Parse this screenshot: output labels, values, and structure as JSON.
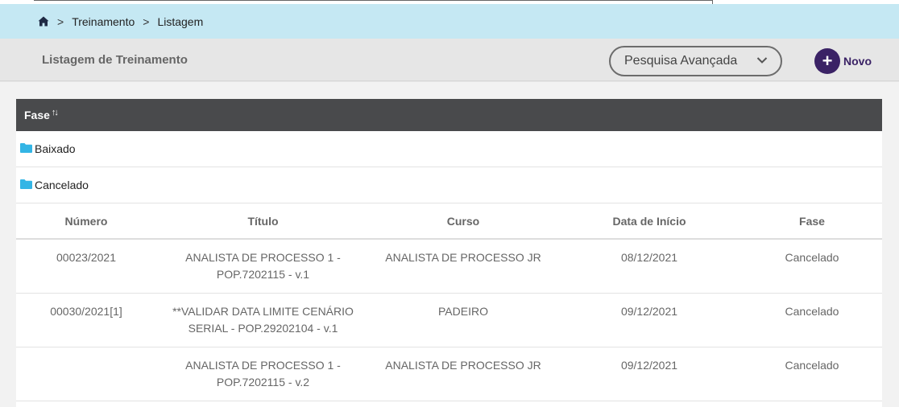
{
  "breadcrumb": {
    "items": [
      "Treinamento",
      "Listagem"
    ],
    "separator": ">"
  },
  "header": {
    "title": "Listagem de Treinamento",
    "advanced_search_label": "Pesquisa Avançada",
    "new_button_label": "Novo",
    "new_button_icon": "+"
  },
  "grid": {
    "group_by_label": "Fase",
    "groups": [
      {
        "label": "Baixado"
      },
      {
        "label": "Cancelado"
      }
    ],
    "columns": [
      "Número",
      "Título",
      "Curso",
      "Data de Início",
      "Fase"
    ],
    "rows": [
      {
        "numero": "00023/2021",
        "titulo": "ANALISTA DE PROCESSO 1 - POP.7202115 - v.1",
        "curso": "ANALISTA DE PROCESSO JR",
        "data_inicio": "08/12/2021",
        "fase": "Cancelado"
      },
      {
        "numero": "00030/2021[1]",
        "titulo": "**VALIDAR DATA LIMITE CENÁRIO SERIAL - POP.29202104 - v.1",
        "curso": "PADEIRO",
        "data_inicio": "09/12/2021",
        "fase": "Cancelado"
      },
      {
        "numero": "",
        "titulo": "ANALISTA DE PROCESSO 1 - POP.7202115 - v.2",
        "curso": "ANALISTA DE PROCESSO JR",
        "data_inicio": "09/12/2021",
        "fase": "Cancelado"
      }
    ]
  },
  "colors": {
    "breadcrumb_bg": "#c5e8f3",
    "grid_header_bg": "#494a4c",
    "accent": "#3a2265",
    "folder": "#33b5e5"
  },
  "icons": {
    "home": "home-icon",
    "chevron": "chevron-down-icon",
    "folder": "folder-icon",
    "sort": "sort-icon"
  }
}
